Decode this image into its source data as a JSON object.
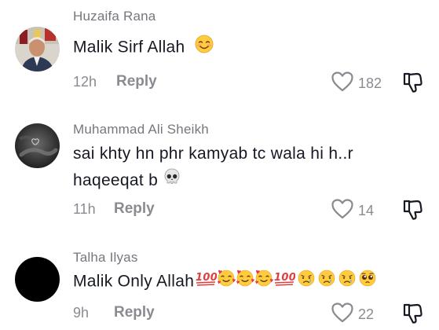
{
  "comments": [
    {
      "username": "Huzaifa Rana",
      "text": "Malik Sirf Allah",
      "time": "12h",
      "reply_label": "Reply",
      "likes": "182",
      "avatar": "profile-photo"
    },
    {
      "username": "Muhammad Ali Sheikh",
      "text_line1": "sai khty hn phr kamyab tc wala hi h..r",
      "text_line2": "haqeeqat b",
      "time": "11h",
      "reply_label": "Reply",
      "likes": "14",
      "avatar": "profile-photo-dark"
    },
    {
      "username": "Talha Ilyas",
      "text": "Malik Only Allah",
      "time": "9h",
      "reply_label": "Reply",
      "likes": "22",
      "avatar": "black-circle"
    }
  ],
  "colors": {
    "text": "#161823",
    "secondary": "#8a8b91",
    "username": "#76777d"
  },
  "icons": [
    "heart-outline-icon",
    "thumbs-down-outline-icon",
    "smiling-face-icon",
    "skull-icon",
    "hundred-points-icon",
    "smiling-face-with-hearts-icon",
    "crying-face-icon",
    "pleading-face-icon"
  ]
}
